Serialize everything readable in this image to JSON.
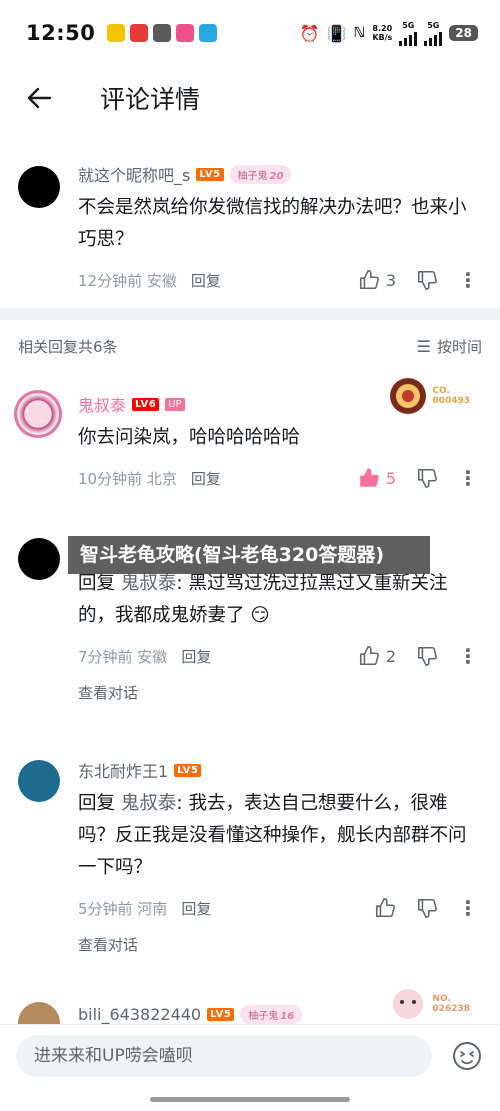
{
  "status_bar": {
    "time": "12:50",
    "net_speed": "8.20",
    "net_unit": "KB/s",
    "sig1": "5G",
    "sig2": "5G",
    "battery": "28",
    "icons": [
      "alarm-icon",
      "vibrate-icon",
      "nfc-icon",
      "signal-icon",
      "signal-icon"
    ]
  },
  "header": {
    "title": "评论详情"
  },
  "root_comment": {
    "username": "就这个昵称吧_s",
    "level": "LV5",
    "fan_badge": "柚子鬼",
    "fan_level": "20",
    "text": "不会是然岚给你发微信找的解决办法吧？也来小巧思？",
    "meta": "12分钟前 安徽",
    "reply_label": "回复",
    "likes": "3"
  },
  "replies_header": {
    "count_label": "相关回复共6条",
    "sort_label": "按时间"
  },
  "replies": [
    {
      "username": "鬼叔泰",
      "level": "LV6",
      "up_tag": "UP",
      "text": "你去问染岚，哈哈哈哈哈哈",
      "meta": "10分钟前 北京",
      "reply_label": "回复",
      "likes": "5",
      "badge_line1": "CO.",
      "badge_line2": "000493"
    },
    {
      "username": "",
      "reply_prefix": "回复",
      "at_user": "鬼叔泰",
      "text": ": 黑过骂过洗过拉黑过又重新关注的，我都成鬼娇妻了",
      "meta": "7分钟前 安徽",
      "reply_label": "回复",
      "likes": "2",
      "view_convo": "查看对话"
    },
    {
      "username": "东北耐炸王1",
      "level": "LV5",
      "reply_prefix": "回复",
      "at_user": "鬼叔泰",
      "text": ": 我去，表达自己想要什么，很难吗？反正我是没看懂这种操作，舰长内部群不问一下吗？",
      "meta": "5分钟前 河南",
      "reply_label": "回复",
      "view_convo": "查看对话"
    },
    {
      "username": "bili_643822440",
      "level": "LV5",
      "fan_badge": "柚子鬼",
      "fan_level": "16",
      "badge_line1": "NO.",
      "badge_line2": "026238"
    }
  ],
  "watermark": "智斗老龟攻略(智斗老龟320答题器)",
  "input": {
    "placeholder": "进来来和UP唠会嗑呗"
  },
  "colors": {
    "pink": "#fb7299",
    "lv5": "#ff6c00",
    "lv6": "#ff0000",
    "divider": "#f1f2f3"
  }
}
